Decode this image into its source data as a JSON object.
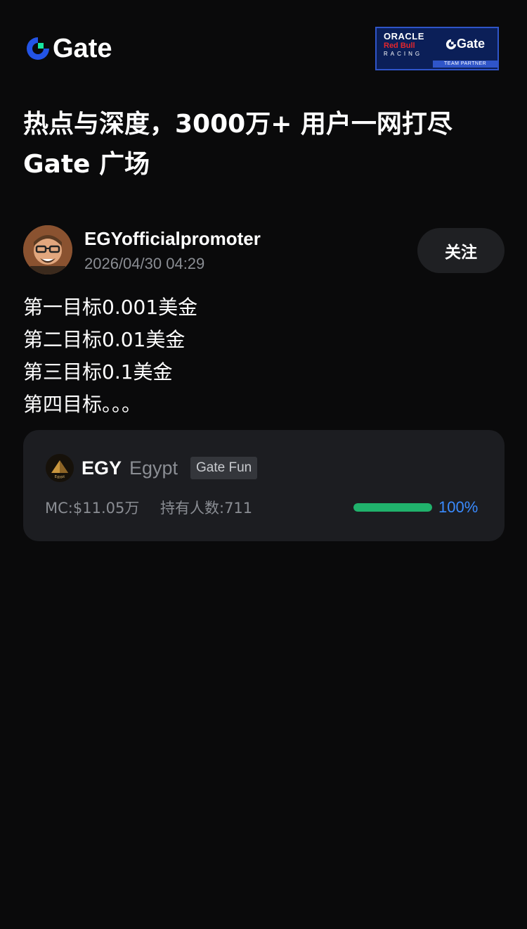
{
  "header": {
    "brand": "Gate",
    "partner": {
      "oracle": "ORACLE",
      "redbull": "Red Bull",
      "racing": "RACING",
      "gate": "Gate",
      "team_partner": "TEAM PARTNER"
    }
  },
  "headline": {
    "line1": "热点与深度，3000万+ 用户一网打尽",
    "line2": "Gate 广场"
  },
  "post": {
    "author": "EGYofficialpromoter",
    "time": "2026/04/30 04:29",
    "follow_label": "关注",
    "lines": [
      "第一目标0.001美金",
      "第二目标0.01美金",
      "第三目标0.1美金",
      "第四目标。。。"
    ]
  },
  "token": {
    "symbol": "EGY",
    "name": "Egypt",
    "icon_caption": "Egypt",
    "tag": "Gate Fun",
    "mc": "MC:$11.05万",
    "holders": "持有人数:711",
    "progress": 100,
    "progress_label": "100%"
  },
  "colors": {
    "background": "#0a0a0b",
    "accent_blue": "#3a8bff",
    "progress_green": "#20b26c",
    "card": "#1c1d21"
  }
}
